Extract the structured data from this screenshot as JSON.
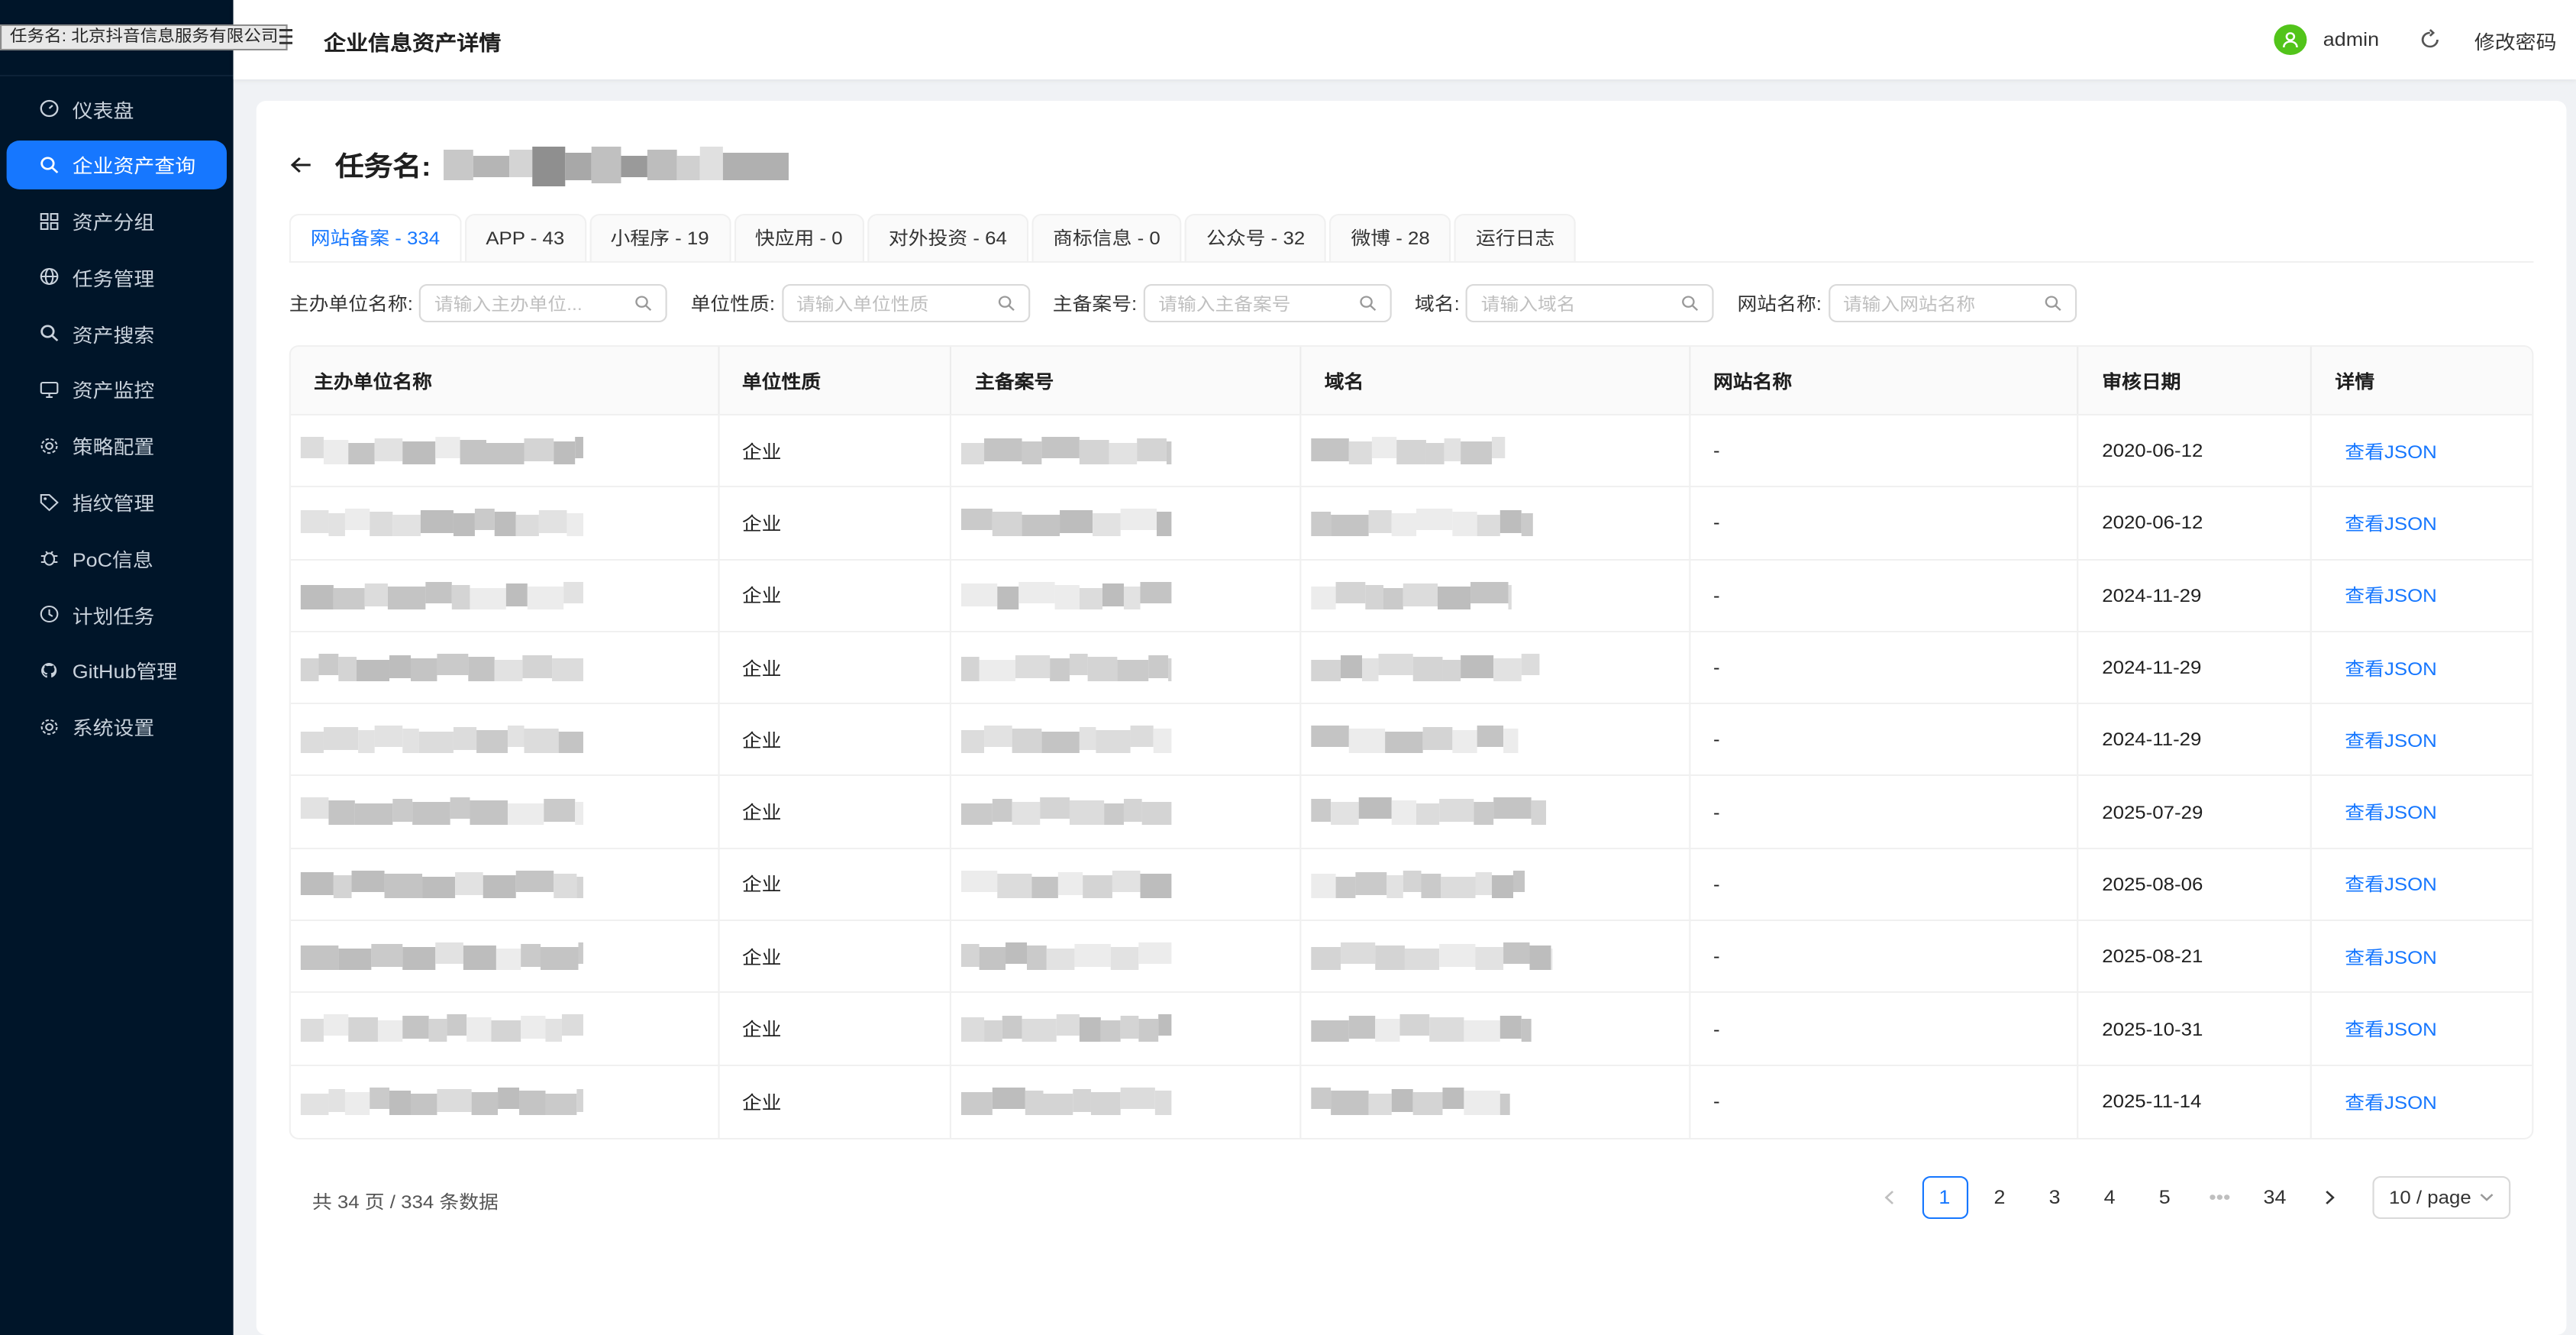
{
  "tooltip": "任务名: 北京抖音信息服务有限公司",
  "app_title": "企业信息资产详情",
  "header": {
    "user": "admin",
    "change_password": "修改密码"
  },
  "sidebar": {
    "items": [
      {
        "label": "仪表盘",
        "icon": "dashboard-icon"
      },
      {
        "label": "企业资产查询",
        "icon": "search-icon",
        "active": true
      },
      {
        "label": "资产分组",
        "icon": "grid-icon"
      },
      {
        "label": "任务管理",
        "icon": "globe-icon"
      },
      {
        "label": "资产搜索",
        "icon": "search-icon"
      },
      {
        "label": "资产监控",
        "icon": "monitor-icon"
      },
      {
        "label": "策略配置",
        "icon": "gear-icon"
      },
      {
        "label": "指纹管理",
        "icon": "tag-icon"
      },
      {
        "label": "PoC信息",
        "icon": "bug-icon"
      },
      {
        "label": "计划任务",
        "icon": "clock-icon"
      },
      {
        "label": "GitHub管理",
        "icon": "github-icon"
      },
      {
        "label": "系统设置",
        "icon": "gear-icon"
      }
    ]
  },
  "page": {
    "title_label": "任务名:"
  },
  "tabs": [
    "网站备案 - 334",
    "APP - 43",
    "小程序 - 19",
    "快应用 - 0",
    "对外投资 - 64",
    "商标信息 - 0",
    "公众号 - 32",
    "微博 - 28",
    "运行日志"
  ],
  "filters": [
    {
      "label": "主办单位名称:",
      "placeholder": "请输入主办单位..."
    },
    {
      "label": "单位性质:",
      "placeholder": "请输入单位性质"
    },
    {
      "label": "主备案号:",
      "placeholder": "请输入主备案号"
    },
    {
      "label": "域名:",
      "placeholder": "请输入域名"
    },
    {
      "label": "网站名称:",
      "placeholder": "请输入网站名称"
    }
  ],
  "table": {
    "columns": [
      "主办单位名称",
      "单位性质",
      "主备案号",
      "域名",
      "网站名称",
      "审核日期",
      "详情"
    ],
    "rows": [
      {
        "type": "企业",
        "site_name": "-",
        "date": "2020-06-12",
        "action": "查看JSON"
      },
      {
        "type": "企业",
        "site_name": "-",
        "date": "2020-06-12",
        "action": "查看JSON"
      },
      {
        "type": "企业",
        "site_name": "-",
        "date": "2024-11-29",
        "action": "查看JSON"
      },
      {
        "type": "企业",
        "site_name": "-",
        "date": "2024-11-29",
        "action": "查看JSON"
      },
      {
        "type": "企业",
        "site_name": "-",
        "date": "2024-11-29",
        "action": "查看JSON"
      },
      {
        "type": "企业",
        "site_name": "-",
        "date": "2025-07-29",
        "action": "查看JSON"
      },
      {
        "type": "企业",
        "site_name": "-",
        "date": "2025-08-06",
        "action": "查看JSON"
      },
      {
        "type": "企业",
        "site_name": "-",
        "date": "2025-08-21",
        "action": "查看JSON"
      },
      {
        "type": "企业",
        "site_name": "-",
        "date": "2025-10-31",
        "action": "查看JSON"
      },
      {
        "type": "企业",
        "site_name": "-",
        "date": "2025-11-14",
        "action": "查看JSON"
      }
    ]
  },
  "pagination": {
    "total_text": "共 34 页 / 334 条数据",
    "pages": [
      "1",
      "2",
      "3",
      "4",
      "5",
      "•••",
      "34"
    ],
    "current": "1",
    "page_size": "10 / page"
  },
  "colors": {
    "primary": "#1677ff",
    "sidebar_bg": "#001529",
    "avatar": "#52c41a"
  }
}
